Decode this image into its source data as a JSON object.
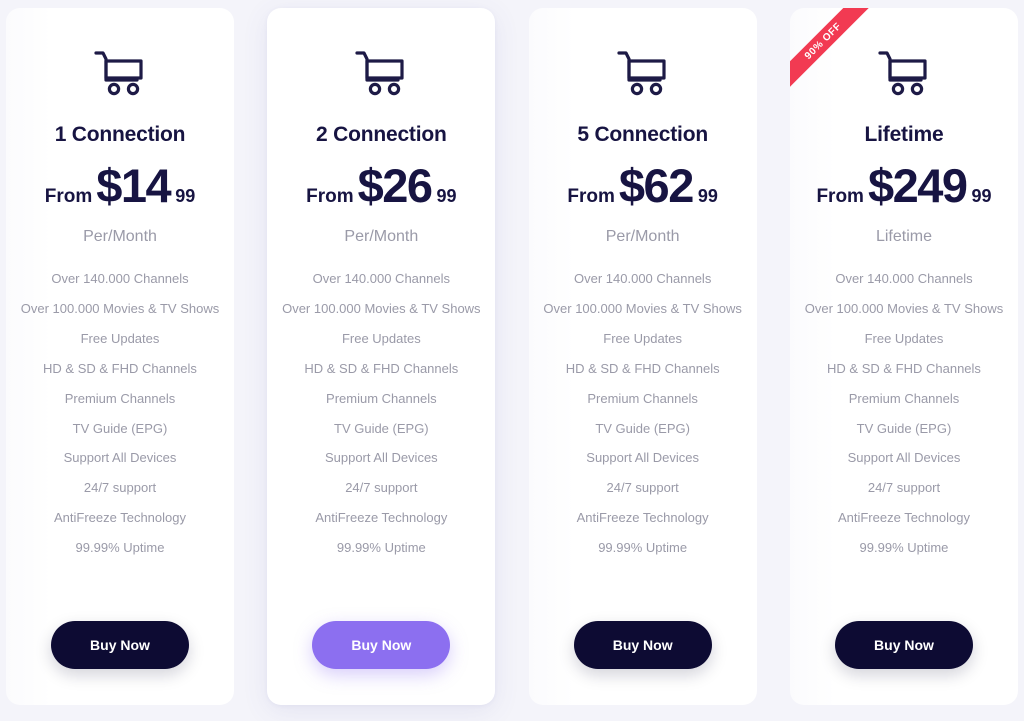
{
  "page": {
    "background_color": "#f4f4fa",
    "accent_color": "#8c6ff0",
    "dark_color": "#0d0b33",
    "ribbon_color": "#f23a52",
    "muted_text_color": "#9a9aa8"
  },
  "shared": {
    "buy_label": "Buy Now",
    "from_label": "From",
    "currency": "$",
    "cart_icon": "shopping-cart-icon",
    "features": [
      "Over 140.000 Channels",
      "Over 100.000 Movies & TV Shows",
      "Free Updates",
      "HD & SD & FHD Channels",
      "Premium Channels",
      "TV Guide (EPG)",
      "Support All Devices",
      "24/7 support",
      "AntiFreeze Technology",
      "99.99% Uptime"
    ]
  },
  "plans": [
    {
      "title": "1 Connection",
      "from_label": "From",
      "price": "$14",
      "cents": "99",
      "period": "Per/Month",
      "buy_label": "Buy Now",
      "featured": false,
      "badge": null
    },
    {
      "title": "2 Connection",
      "from_label": "From",
      "price": "$26",
      "cents": "99",
      "period": "Per/Month",
      "buy_label": "Buy Now",
      "featured": true,
      "badge": null
    },
    {
      "title": "5 Connection",
      "from_label": "From",
      "price": "$62",
      "cents": "99",
      "period": "Per/Month",
      "buy_label": "Buy Now",
      "featured": false,
      "badge": null
    },
    {
      "title": "Lifetime",
      "from_label": "From",
      "price": "$249",
      "cents": "99",
      "period": "Lifetime",
      "buy_label": "Buy Now",
      "featured": false,
      "badge": "90% OFF"
    }
  ]
}
